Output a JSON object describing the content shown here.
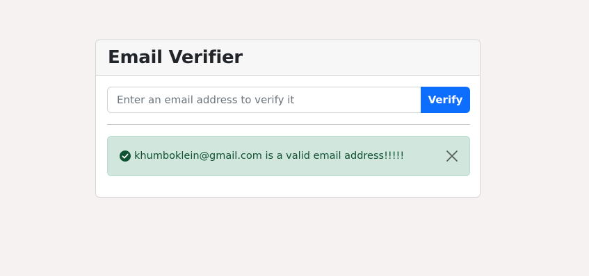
{
  "header": {
    "title": "Email Verifier"
  },
  "form": {
    "email_placeholder": "Enter an email address to verify it",
    "email_value": "",
    "verify_label": "Verify"
  },
  "alert": {
    "icon": "check-circle-icon",
    "message": "khumboklein@gmail.com is a valid email address!!!!!",
    "close_icon": "close-icon"
  },
  "colors": {
    "page_background": "#f5f2f1",
    "primary_button": "#0d6efd",
    "alert_background": "#d1e7dd",
    "alert_text": "#0f5132"
  }
}
